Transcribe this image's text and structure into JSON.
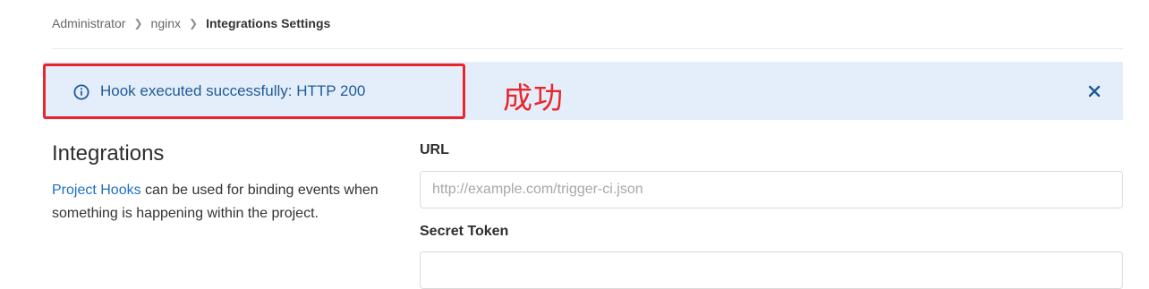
{
  "breadcrumb": {
    "items": [
      "Administrator",
      "nginx",
      "Integrations Settings"
    ]
  },
  "flash": {
    "message": "Hook executed successfully: HTTP 200",
    "annotation": "成功",
    "type": "info",
    "icon": "info-circle-icon",
    "close_icon": "close-icon",
    "accent_color": "#1f5a96",
    "background_color": "#e4eefb",
    "highlight_color": "#e8262b"
  },
  "integrations": {
    "title": "Integrations",
    "description_link": "Project Hooks",
    "description_rest": " can be used for binding events when something is happening within the project."
  },
  "form": {
    "url_label": "URL",
    "url_placeholder": "http://example.com/trigger-ci.json",
    "url_value": "",
    "secret_token_label": "Secret Token",
    "secret_token_value": ""
  }
}
